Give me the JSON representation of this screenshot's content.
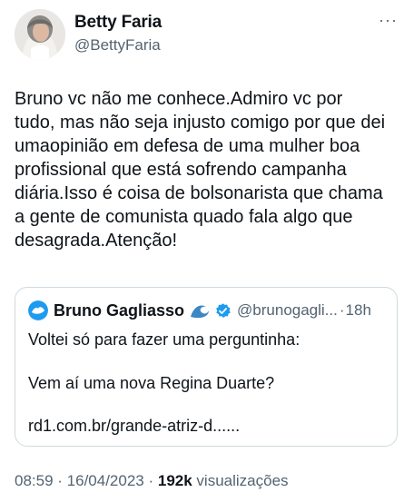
{
  "author": {
    "name": "Betty Faria",
    "handle": "@BettyFaria"
  },
  "more_icon": "more-dots-icon",
  "tweet": {
    "text": "Bruno vc não me conhece.Admiro vc por\ntudo, mas não seja injusto comigo por que dei\numaopinião em defesa de uma mulher boa\nprofissional que está sofrendo campanha\ndiária.Isso é coisa de bolsonarista que chama\na gente de comunista quado fala algo que\ndesagrada.Atenção!"
  },
  "quote": {
    "name": "Bruno Gagliasso",
    "emoji_icon": "wave-emoji-icon",
    "verified_icon": "verified-badge-icon",
    "handle": "@brunogagli...",
    "separator": "·",
    "time": "18h",
    "line1": "Voltei só para fazer uma perguntinha:",
    "line2": "Vem aí uma nova Regina Duarte?",
    "link": "rd1.com.br/grande-atriz-d......"
  },
  "meta": {
    "time": "08:59",
    "sep1": " · ",
    "date": "16/04/2023",
    "sep2": " · ",
    "views_count": "192k",
    "views_label": "visualizações"
  },
  "colors": {
    "text": "#0f1419",
    "secondary": "#536471",
    "border": "#cfd9de",
    "verified": "#1d9bf0"
  }
}
